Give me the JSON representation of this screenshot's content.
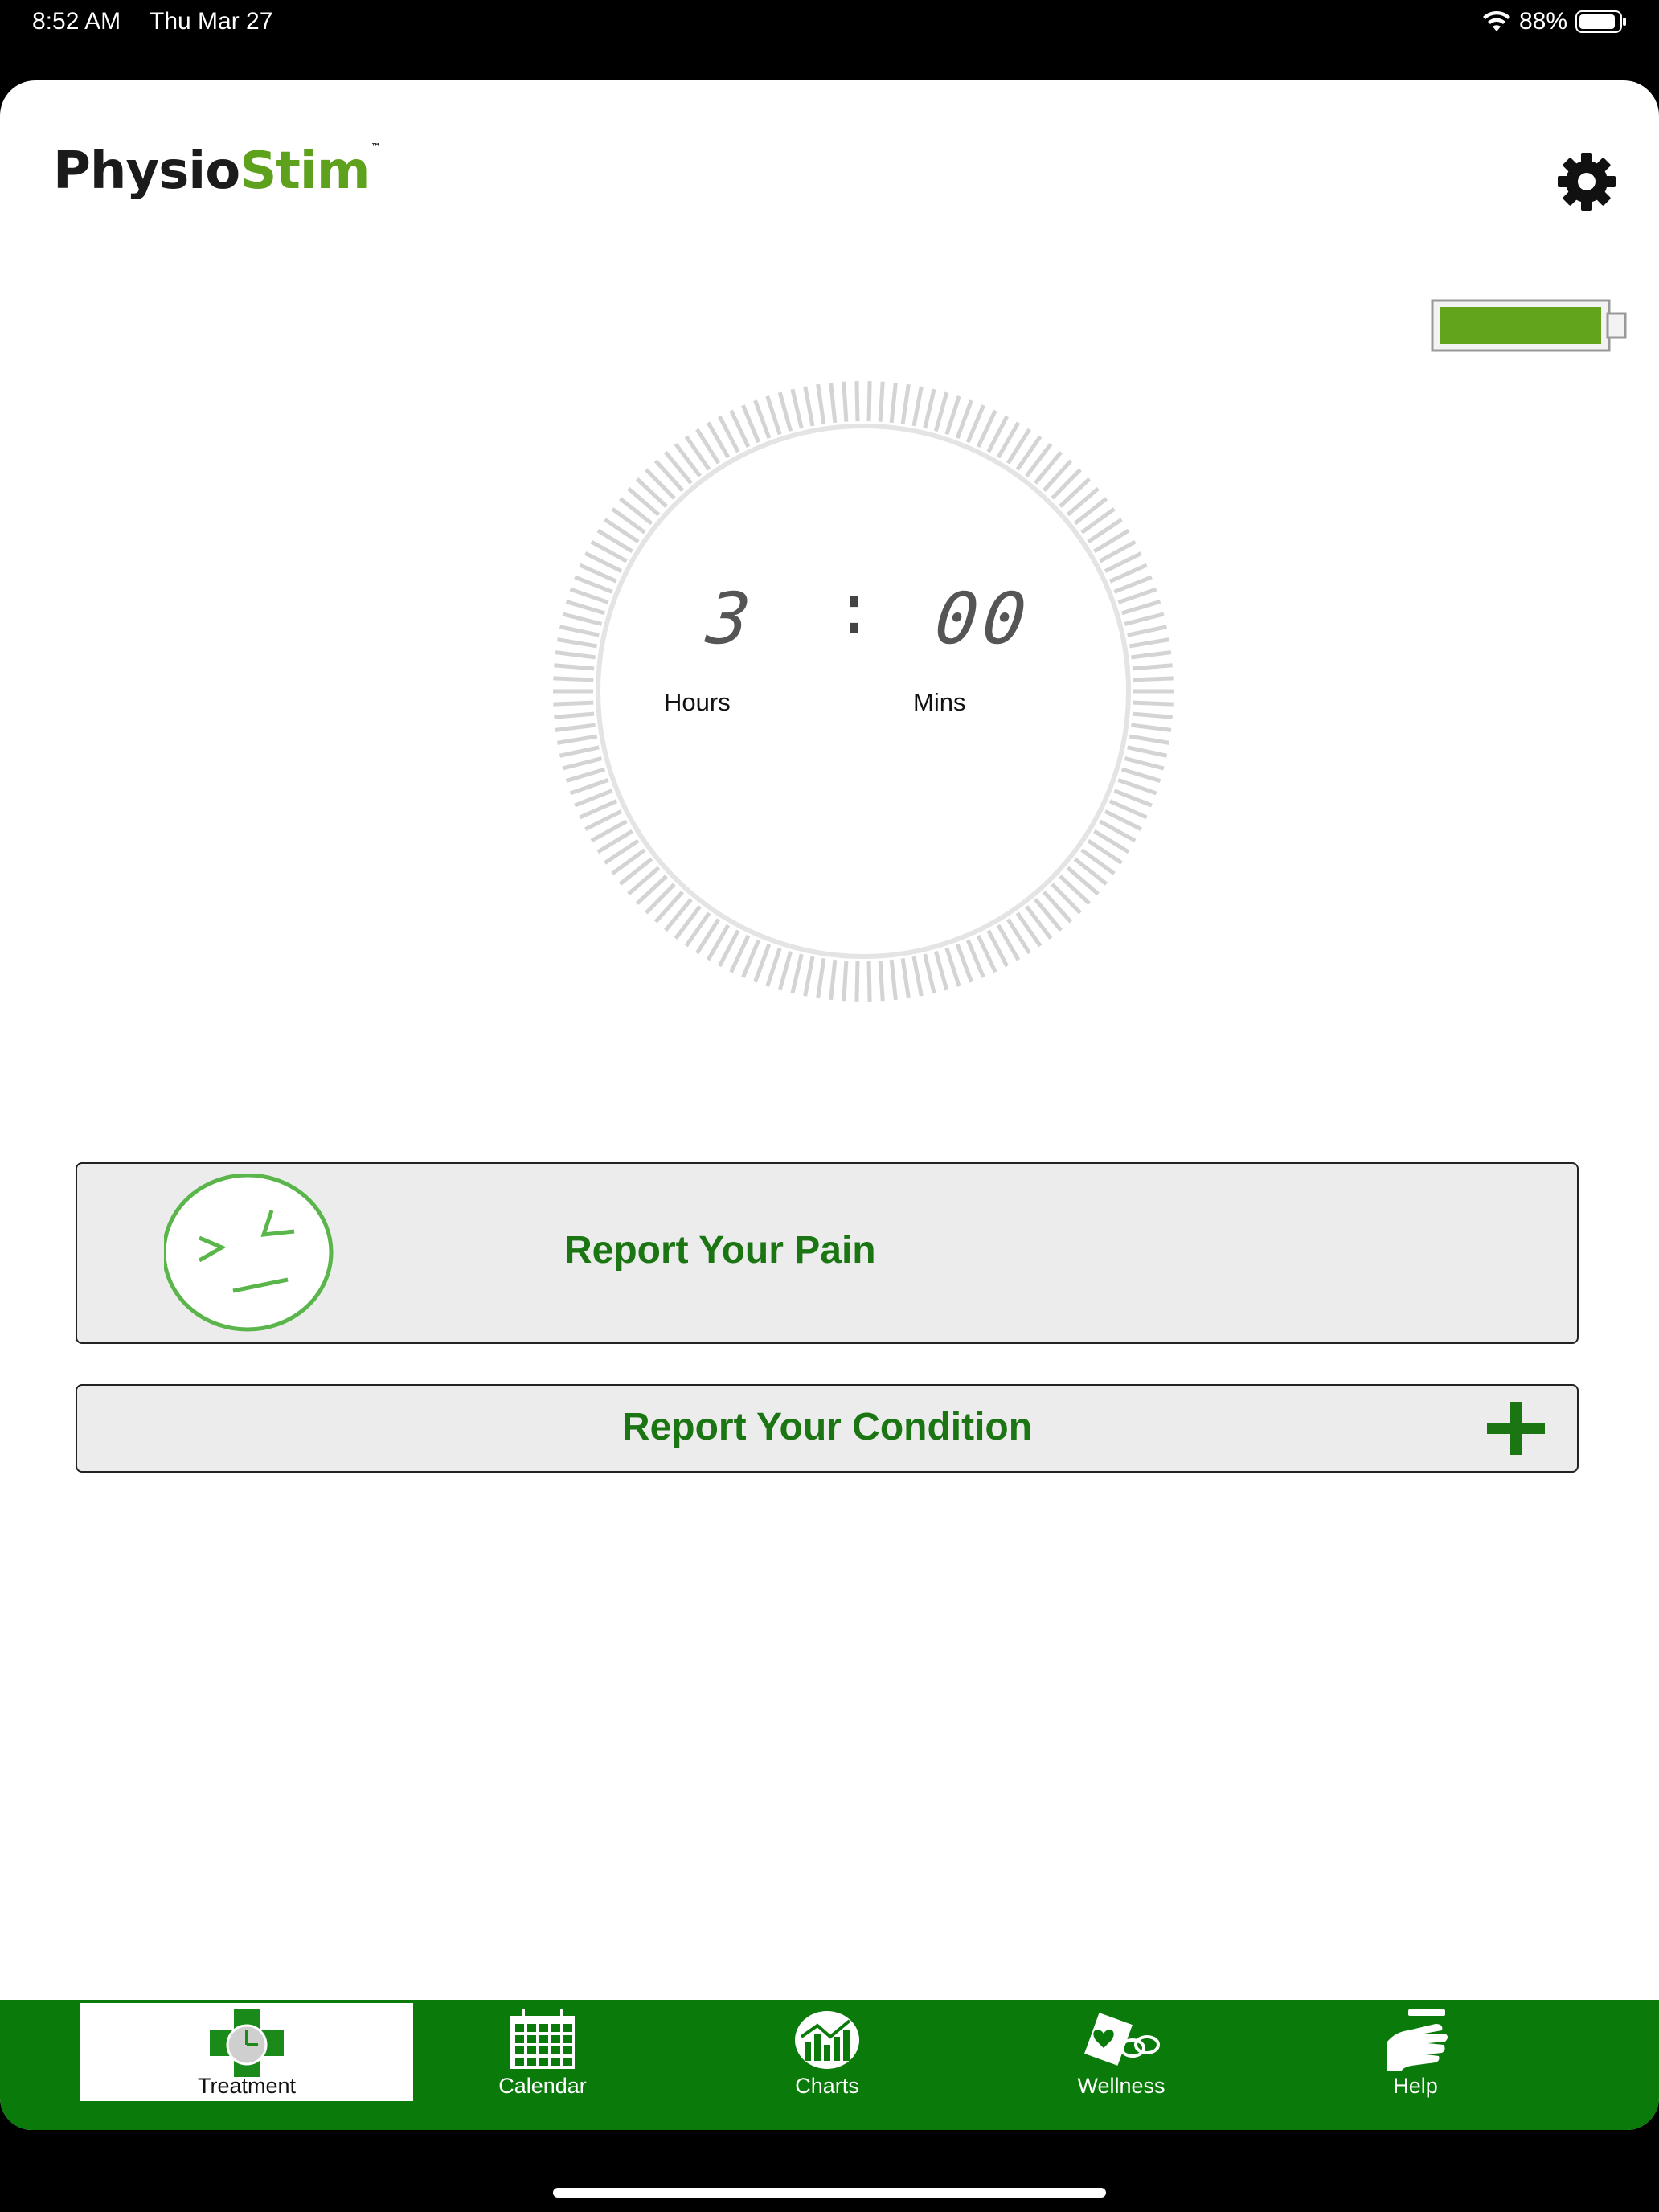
{
  "status_bar": {
    "time": "8:52 AM",
    "date": "Thu Mar 27",
    "battery_percent": "88%"
  },
  "app": {
    "logo_part1": "Physio",
    "logo_part2": "Stim",
    "logo_tm": "™",
    "device_battery_level": 1.0
  },
  "timer": {
    "hours": "3",
    "separator": ":",
    "minutes": "00",
    "hours_label": "Hours",
    "minutes_label": "Mins"
  },
  "actions": {
    "report_pain": "Report Your Pain",
    "report_condition": "Report Your Condition"
  },
  "tabs": [
    {
      "label": "Treatment",
      "icon": "treatment-clock-cross-icon",
      "active": true
    },
    {
      "label": "Calendar",
      "icon": "calendar-icon",
      "active": false
    },
    {
      "label": "Charts",
      "icon": "charts-icon",
      "active": false
    },
    {
      "label": "Wellness",
      "icon": "wellness-icon",
      "active": false
    },
    {
      "label": "Help",
      "icon": "help-hand-icon",
      "active": false
    }
  ],
  "colors": {
    "brand_green": "#5ea11d",
    "button_text_green": "#1a7512",
    "tabbar_green": "#0a7a0a",
    "battery_fill": "#62a51c"
  }
}
